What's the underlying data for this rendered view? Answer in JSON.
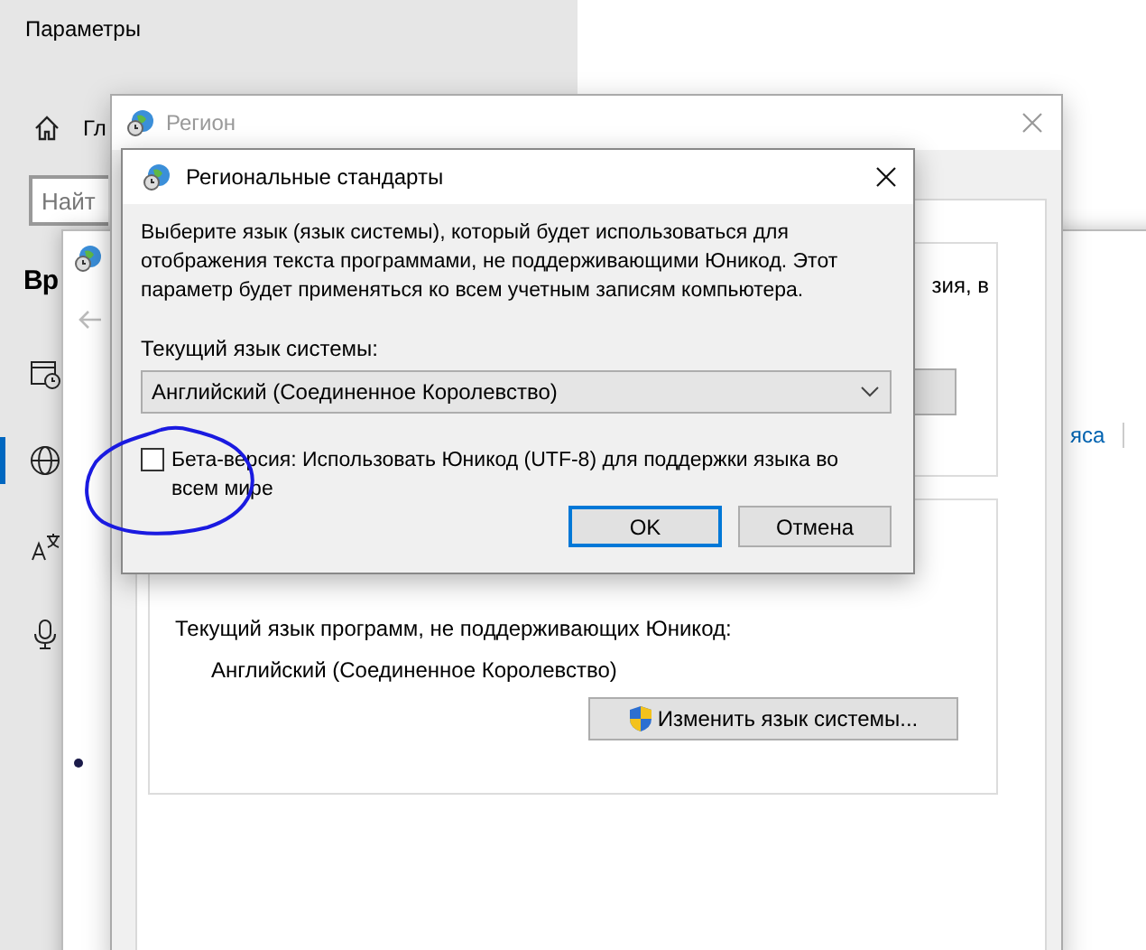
{
  "settings_app": {
    "title": "Параметры",
    "home_label": "Гл",
    "search": {
      "placeholder": "Найт"
    },
    "heading": "Вр",
    "sidebar": {
      "items": [
        {
          "kind": "calendar",
          "selected": false
        },
        {
          "kind": "globe",
          "selected": true
        },
        {
          "kind": "language",
          "selected": false
        },
        {
          "kind": "microphone",
          "selected": false
        }
      ]
    }
  },
  "date_time_window": {
    "links": [
      "яса"
    ]
  },
  "region_window": {
    "title": "Регион",
    "group_1": {
      "text_fragment": "зия, в"
    },
    "group_2": {
      "label": "Текущий язык программ, не поддерживающих Юникод:",
      "value": "Английский (Соединенное Королевство)",
      "button": "Изменить язык системы..."
    }
  },
  "dialog": {
    "title": "Региональные стандарты",
    "description": "Выберите язык (язык системы), который будет использоваться для отображения текста программами, не поддерживающими Юникод. Этот параметр будет применяться ко всем учетным записям компьютера.",
    "current_label": "Текущий язык системы:",
    "dropdown": {
      "value": "Английский (Соединенное Королевство)"
    },
    "beta_checkbox": {
      "label": "Бета-версия: Использовать Юникод (UTF-8) для поддержки языка во всем мире",
      "checked": false
    },
    "buttons": [
      {
        "label": "OK",
        "default": true
      },
      {
        "label": "Отмена",
        "default": false
      }
    ]
  }
}
